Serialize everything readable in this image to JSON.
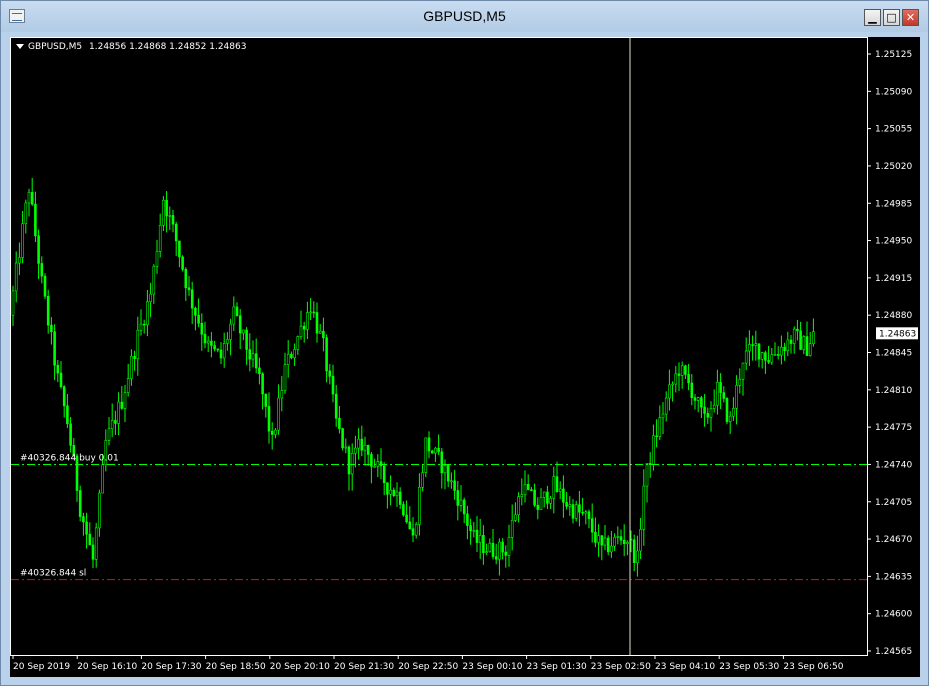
{
  "window": {
    "title": "GBPUSD,M5",
    "minimize_icon": "minimize-icon",
    "restore_icon": "restore-icon",
    "close_icon": "close-icon"
  },
  "chart_header": {
    "symbol": "GBPUSD,M5",
    "ohlc": "1.24856 1.24868 1.24852 1.24863"
  },
  "colors": {
    "background": "#000000",
    "candle": "#00ff00",
    "entry_line": "#00ff00",
    "sl_line": "#ff0000",
    "cursor_line": "#e6e6c8",
    "axis": "#ffffff"
  },
  "lines": {
    "entry": {
      "price": 1.2474,
      "label": "#40326.844 buy 0.01"
    },
    "sl": {
      "price": 1.24632,
      "label": "#40326.844 sl"
    }
  },
  "chart_data": {
    "type": "candlestick",
    "ylim": [
      1.2455,
      1.2516
    ],
    "y_ticks": [
      "1.25125",
      "1.25090",
      "1.25055",
      "1.25020",
      "1.24985",
      "1.24950",
      "1.24915",
      "1.24880",
      "1.24845",
      "1.24810",
      "1.24775",
      "1.24740",
      "1.24705",
      "1.24670",
      "1.24635",
      "1.24600",
      "1.24565"
    ],
    "x_ticks": [
      "20 Sep 2019",
      "20 Sep 16:10",
      "20 Sep 17:30",
      "20 Sep 18:50",
      "20 Sep 20:10",
      "20 Sep 21:30",
      "20 Sep 22:50",
      "23 Sep 00:10",
      "23 Sep 01:30",
      "23 Sep 02:50",
      "23 Sep 04:10",
      "23 Sep 05:30",
      "23 Sep 06:50"
    ],
    "current_price": "1.24863",
    "bar_count": 193,
    "keypoints": [
      [
        0,
        1.2488
      ],
      [
        6,
        1.25
      ],
      [
        10,
        1.2491
      ],
      [
        15,
        1.2482
      ],
      [
        18,
        1.2478
      ],
      [
        22,
        1.247
      ],
      [
        26,
        1.2465
      ],
      [
        30,
        1.2476
      ],
      [
        35,
        1.248
      ],
      [
        40,
        1.2486
      ],
      [
        44,
        1.249
      ],
      [
        48,
        1.2499
      ],
      [
        52,
        1.2495
      ],
      [
        56,
        1.249
      ],
      [
        62,
        1.2485
      ],
      [
        66,
        1.2484
      ],
      [
        70,
        1.2488
      ],
      [
        74,
        1.2485
      ],
      [
        78,
        1.2482
      ],
      [
        82,
        1.2476
      ],
      [
        86,
        1.2483
      ],
      [
        90,
        1.2486
      ],
      [
        94,
        1.2489
      ],
      [
        98,
        1.2485
      ],
      [
        102,
        1.2478
      ],
      [
        106,
        1.2474
      ],
      [
        110,
        1.2476
      ],
      [
        114,
        1.2474
      ],
      [
        118,
        1.2472
      ],
      [
        122,
        1.2471
      ],
      [
        126,
        1.2467
      ],
      [
        130,
        1.2476
      ],
      [
        135,
        1.2474
      ],
      [
        140,
        1.2471
      ],
      [
        145,
        1.2467
      ],
      [
        150,
        1.2466
      ],
      [
        155,
        1.2466
      ],
      [
        160,
        1.2472
      ],
      [
        165,
        1.247
      ],
      [
        170,
        1.2472
      ],
      [
        175,
        1.247
      ],
      [
        180,
        1.2469
      ],
      [
        185,
        1.2466
      ],
      [
        190,
        1.2467
      ],
      [
        193,
        1.2467
      ]
    ],
    "keypoints2": [
      [
        0,
        1.2467
      ],
      [
        3,
        1.2465
      ],
      [
        5,
        1.2472
      ],
      [
        8,
        1.2476
      ],
      [
        12,
        1.248
      ],
      [
        16,
        1.2483
      ],
      [
        20,
        1.2481
      ],
      [
        24,
        1.2478
      ],
      [
        28,
        1.2481
      ],
      [
        32,
        1.2478
      ],
      [
        36,
        1.2484
      ],
      [
        40,
        1.2485
      ],
      [
        44,
        1.2484
      ],
      [
        48,
        1.2485
      ],
      [
        52,
        1.2486
      ],
      [
        56,
        1.2485
      ],
      [
        58,
        1.24863
      ]
    ]
  }
}
